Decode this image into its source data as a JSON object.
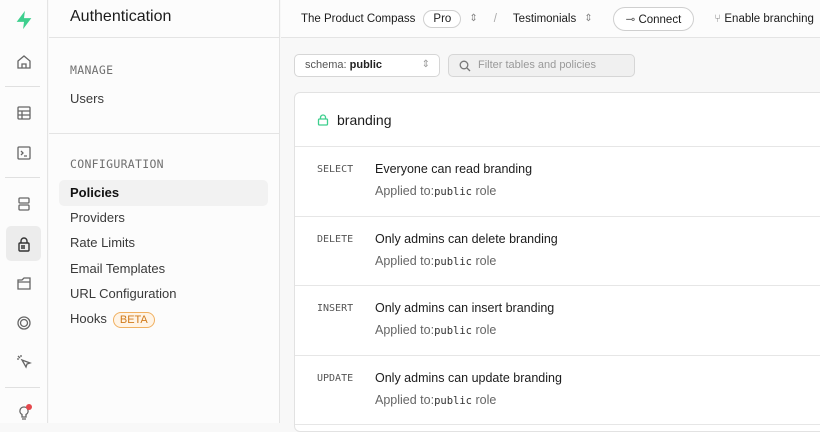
{
  "sidebar": {
    "title": "Authentication",
    "manage_label": "MANAGE",
    "manage_items": [
      "Users"
    ],
    "config_label": "CONFIGURATION",
    "config_items": [
      "Policies",
      "Providers",
      "Rate Limits",
      "Email Templates",
      "URL Configuration",
      "Hooks"
    ],
    "hooks_badge": "BETA",
    "active": "Policies"
  },
  "topbar": {
    "org": "The Product Compass",
    "plan": "Pro",
    "separator": "/",
    "project": "Testimonials",
    "connect": "Connect",
    "branching": "Enable branching"
  },
  "toolbar": {
    "schema_label": "schema:",
    "schema_value": "public",
    "filter_placeholder": "Filter tables and policies"
  },
  "table": {
    "name": "branding",
    "policies": [
      {
        "command": "SELECT",
        "name": "Everyone can read branding",
        "applied_prefix": "Applied to:",
        "role": "public",
        "suffix": " role"
      },
      {
        "command": "DELETE",
        "name": "Only admins can delete branding",
        "applied_prefix": "Applied to:",
        "role": "public",
        "suffix": " role"
      },
      {
        "command": "INSERT",
        "name": "Only admins can insert branding",
        "applied_prefix": "Applied to:",
        "role": "public",
        "suffix": " role"
      },
      {
        "command": "UPDATE",
        "name": "Only admins can update branding",
        "applied_prefix": "Applied to:",
        "role": "public",
        "suffix": " role"
      }
    ]
  },
  "colors": {
    "brand": "#3ecf8e",
    "badge": "#d07a1a",
    "notification": "#e5484d"
  }
}
